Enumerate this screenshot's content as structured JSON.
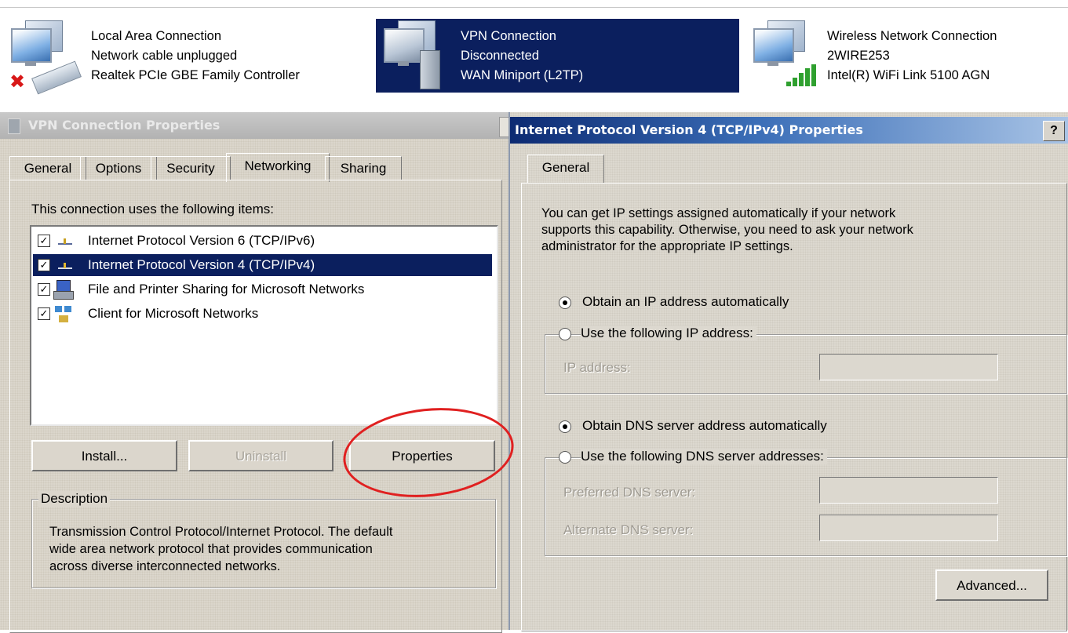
{
  "connections": [
    {
      "name": "Local Area Connection",
      "status": "Network cable unplugged",
      "device": "Realtek PCIe GBE Family Controller"
    },
    {
      "name": "VPN Connection",
      "status": "Disconnected",
      "device": "WAN Miniport (L2TP)"
    },
    {
      "name": "Wireless Network Connection",
      "status": "2WIRE253",
      "device": "Intel(R) WiFi Link 5100 AGN"
    }
  ],
  "vpn_props": {
    "title": "VPN Connection Properties",
    "tabs": [
      "General",
      "Options",
      "Security",
      "Networking",
      "Sharing"
    ],
    "active_tab": "Networking",
    "items_label": "This connection uses the following items:",
    "items": [
      {
        "label": "Internet Protocol Version 6 (TCP/IPv6)",
        "checked": true
      },
      {
        "label": "Internet Protocol Version 4 (TCP/IPv4)",
        "checked": true
      },
      {
        "label": "File and Printer Sharing for Microsoft Networks",
        "checked": true
      },
      {
        "label": "Client for Microsoft Networks",
        "checked": true
      }
    ],
    "install_label": "Install...",
    "uninstall_label": "Uninstall",
    "properties_label": "Properties",
    "description_label": "Description",
    "description_lines": [
      "Transmission Control Protocol/Internet Protocol. The default",
      "wide area network protocol that provides communication",
      "across diverse interconnected networks."
    ]
  },
  "ipv4_props": {
    "title": "Internet Protocol Version 4 (TCP/IPv4) Properties",
    "help": "?",
    "tab": "General",
    "intro_lines": [
      "You can get IP settings assigned automatically if your network",
      "supports this capability. Otherwise, you need to ask your network",
      "administrator for the appropriate IP settings."
    ],
    "obtain_ip": "Obtain an IP address automatically",
    "use_ip": "Use the following IP address:",
    "ip_address_label": "IP address:",
    "obtain_dns": "Obtain DNS server address automatically",
    "use_dns": "Use the following DNS server addresses:",
    "preferred_dns_label": "Preferred DNS server:",
    "alternate_dns_label": "Alternate DNS server:",
    "advanced_label": "Advanced..."
  },
  "colors": {
    "selection": "#0b1f5e",
    "annotation": "#e02020"
  }
}
